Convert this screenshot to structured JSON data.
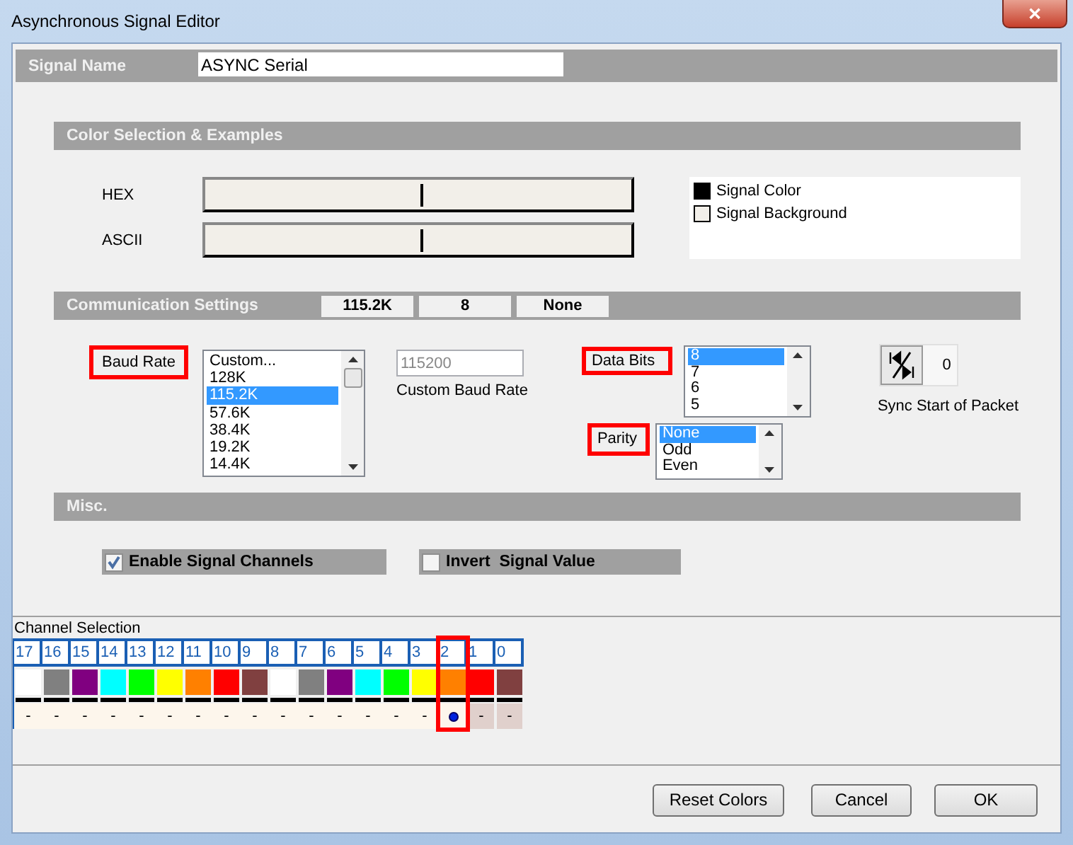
{
  "window": {
    "title": "Asynchronous Signal Editor",
    "close": "✕"
  },
  "signal_name": {
    "label": "Signal Name",
    "value": "ASYNC Serial"
  },
  "color_selection": {
    "title": "Color Selection & Examples",
    "rows": [
      {
        "label": "HEX"
      },
      {
        "label": "ASCII"
      }
    ],
    "legend": [
      {
        "label": "Signal Color",
        "color": "#000000"
      },
      {
        "label": "Signal Background",
        "color": "#f2efe9"
      }
    ]
  },
  "communication": {
    "title": "Communication Settings",
    "summary": [
      "115.2K",
      "8",
      "None"
    ],
    "baud_rate": {
      "label": "Baud Rate",
      "highlighted": true,
      "items": [
        {
          "label": "Custom...",
          "selected": false
        },
        {
          "label": "128K",
          "selected": false
        },
        {
          "label": "115.2K",
          "selected": true
        },
        {
          "label": "57.6K",
          "selected": false
        },
        {
          "label": "38.4K",
          "selected": false
        },
        {
          "label": "19.2K",
          "selected": false
        },
        {
          "label": "14.4K",
          "selected": false
        }
      ]
    },
    "custom_baud": {
      "value": "115200",
      "label": "Custom Baud Rate",
      "disabled": true
    },
    "data_bits": {
      "label": "Data Bits",
      "highlighted": true,
      "items": [
        {
          "label": "8",
          "selected": true
        },
        {
          "label": "7",
          "selected": false
        },
        {
          "label": "6",
          "selected": false
        },
        {
          "label": "5",
          "selected": false
        }
      ]
    },
    "parity": {
      "label": "Parity",
      "highlighted": true,
      "items": [
        {
          "label": "None",
          "selected": true
        },
        {
          "label": "Odd",
          "selected": false
        },
        {
          "label": "Even",
          "selected": false
        }
      ]
    },
    "sync": {
      "value": "0",
      "label": "Sync Start of Packet"
    }
  },
  "misc": {
    "title": "Misc.",
    "checkboxes": [
      {
        "label": "Enable Signal Channels",
        "checked": true
      },
      {
        "label": "Invert  Signal Value",
        "checked": false
      }
    ]
  },
  "channels": {
    "title": "Channel Selection",
    "items": [
      {
        "label": "17",
        "color": "#ffffff",
        "value": "-",
        "selected": false,
        "disabled": false,
        "highlighted": false
      },
      {
        "label": "16",
        "color": "#808080",
        "value": "-",
        "selected": false,
        "disabled": false,
        "highlighted": false
      },
      {
        "label": "15",
        "color": "#800080",
        "value": "-",
        "selected": false,
        "disabled": false,
        "highlighted": false
      },
      {
        "label": "14",
        "color": "#00ffff",
        "value": "-",
        "selected": false,
        "disabled": false,
        "highlighted": false
      },
      {
        "label": "13",
        "color": "#00ff00",
        "value": "-",
        "selected": false,
        "disabled": false,
        "highlighted": false
      },
      {
        "label": "12",
        "color": "#ffff00",
        "value": "-",
        "selected": false,
        "disabled": false,
        "highlighted": false
      },
      {
        "label": "11",
        "color": "#ff8000",
        "value": "-",
        "selected": false,
        "disabled": false,
        "highlighted": false
      },
      {
        "label": "10",
        "color": "#ff0000",
        "value": "-",
        "selected": false,
        "disabled": false,
        "highlighted": false
      },
      {
        "label": "9",
        "color": "#804040",
        "value": "-",
        "selected": false,
        "disabled": false,
        "highlighted": false
      },
      {
        "label": "8",
        "color": "#ffffff",
        "value": "-",
        "selected": false,
        "disabled": false,
        "highlighted": false
      },
      {
        "label": "7",
        "color": "#808080",
        "value": "-",
        "selected": false,
        "disabled": false,
        "highlighted": false
      },
      {
        "label": "6",
        "color": "#800080",
        "value": "-",
        "selected": false,
        "disabled": false,
        "highlighted": false
      },
      {
        "label": "5",
        "color": "#00ffff",
        "value": "-",
        "selected": false,
        "disabled": false,
        "highlighted": false
      },
      {
        "label": "4",
        "color": "#00ff00",
        "value": "-",
        "selected": false,
        "disabled": false,
        "highlighted": false
      },
      {
        "label": "3",
        "color": "#ffff00",
        "value": "-",
        "selected": false,
        "disabled": false,
        "highlighted": false
      },
      {
        "label": "2",
        "color": "#ff8000",
        "selected": true,
        "disabled": false,
        "highlighted": true
      },
      {
        "label": "1",
        "color": "#ff0000",
        "value": "-",
        "selected": false,
        "disabled": true,
        "highlighted": false
      },
      {
        "label": "0",
        "color": "#804040",
        "value": "-",
        "selected": false,
        "disabled": true,
        "highlighted": false
      }
    ]
  },
  "buttons": [
    "Reset Colors",
    "Cancel",
    "OK"
  ]
}
